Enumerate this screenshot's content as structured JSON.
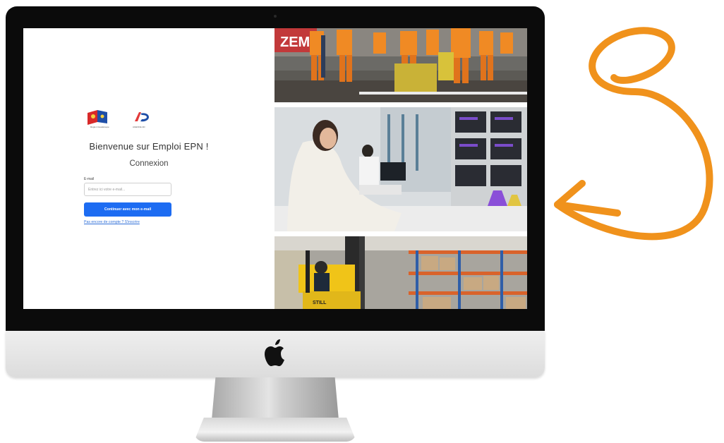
{
  "login": {
    "logo_region_caption": "Région Guadeloupe",
    "logo_ad_caption": "AGENCE AD",
    "welcome_title": "Bienvenue sur Emploi EPN !",
    "heading": "Connexion",
    "email_label": "E-mail",
    "email_placeholder": "Entrez ici votre e-mail...",
    "continue_button": "Continuer avec mon e-mail",
    "signup_link": "Pas encore de compte ? S'inscrire"
  },
  "photos": {
    "workers_sign": "ZEM",
    "forklift_brand": "STILL"
  },
  "icons": {
    "apple": "apple-logo-icon",
    "arrow": "curly-arrow-icon"
  },
  "colors": {
    "accent": "#1d6cf2",
    "link": "#2f6fd8",
    "decor_arrow": "#f0921c",
    "bezel": "#0b0b0b"
  }
}
